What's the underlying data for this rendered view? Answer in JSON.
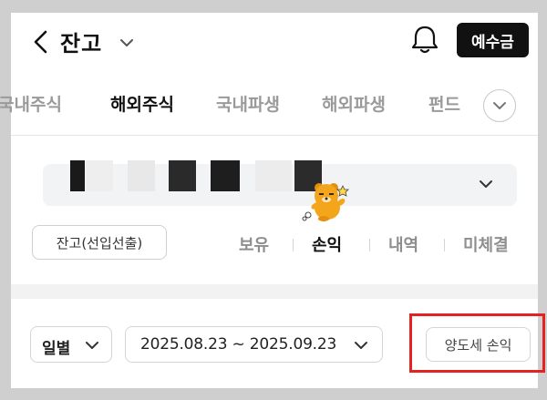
{
  "header": {
    "title": "잔고",
    "deposit_label": "예수금",
    "icons": {
      "back": "back-arrow-icon",
      "title_dropdown": "chevron-down-icon",
      "notifications": "bell-icon"
    }
  },
  "tabs": [
    {
      "label": "국내주식",
      "active": false
    },
    {
      "label": "해외주식",
      "active": true
    },
    {
      "label": "국내파생",
      "active": false
    },
    {
      "label": "해외파생",
      "active": false
    },
    {
      "label": "펀드",
      "active": false
    }
  ],
  "account": {
    "value": "",
    "redacted": true
  },
  "balance_filter": {
    "label": "잔고(선입선출)"
  },
  "subtabs": [
    {
      "label": "보유",
      "active": false
    },
    {
      "label": "손익",
      "active": true
    },
    {
      "label": "내역",
      "active": false
    },
    {
      "label": "미체결",
      "active": false
    }
  ],
  "filters": {
    "period": "일별",
    "date_range": "2025.08.23 ~ 2025.09.23",
    "tax_button": "양도세 손익"
  },
  "colors": {
    "primary": "#111111",
    "inactive_text": "#9a9a9a",
    "highlight": "#e32222",
    "select_bg": "#f2f3f5",
    "frame": "#cfcfcf"
  }
}
